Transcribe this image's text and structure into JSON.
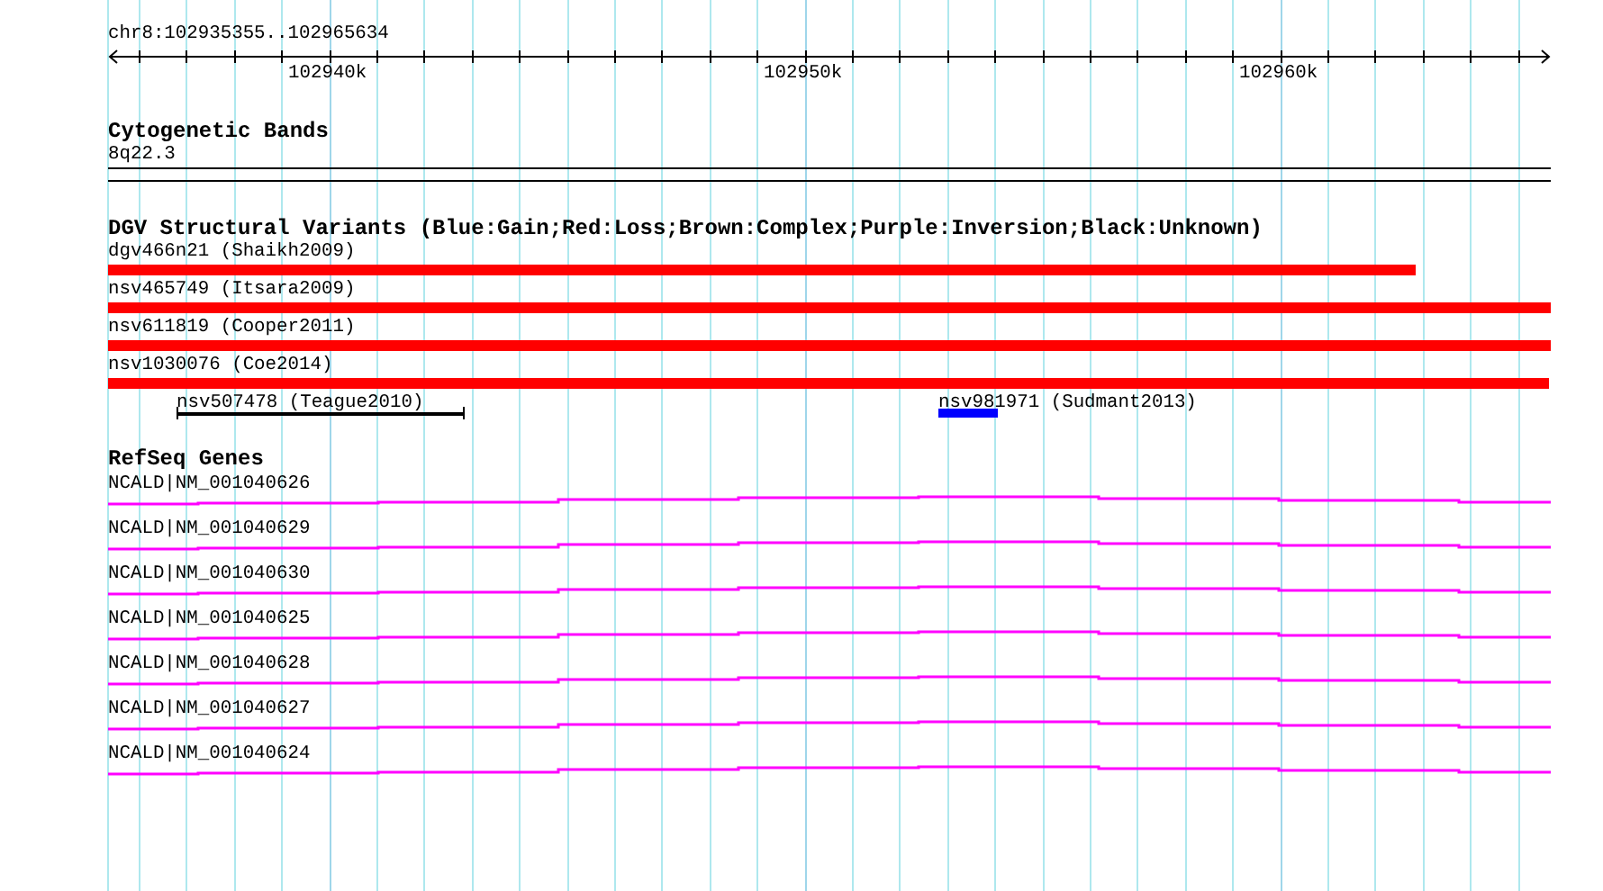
{
  "ruler": {
    "range_label": "chr8:102935355..102965634",
    "tick_labels": [
      "102940k",
      "102950k",
      "102960k"
    ]
  },
  "bands": {
    "title": "Cytogenetic Bands",
    "label": "8q22.3"
  },
  "variants": {
    "title": "DGV Structural Variants (Blue:Gain;Red:Loss;Brown:Complex;Purple:Inversion;Black:Unknown)",
    "rows": [
      {
        "items": [
          {
            "label": "dgv466n21 (Shaikh2009)",
            "kind": "bar",
            "color": "#ff0000"
          }
        ]
      },
      {
        "items": [
          {
            "label": "nsv465749 (Itsara2009)",
            "kind": "bar",
            "color": "#ff0000"
          }
        ]
      },
      {
        "items": [
          {
            "label": "nsv611819 (Cooper2011)",
            "kind": "bar",
            "color": "#ff0000"
          }
        ]
      },
      {
        "items": [
          {
            "label": "nsv1030076 (Coe2014)",
            "kind": "bar",
            "color": "#ff0000"
          }
        ]
      },
      {
        "items": [
          {
            "label": "nsv507478 (Teague2010)",
            "kind": "range",
            "color": "#000000"
          },
          {
            "label": "nsv981971 (Sudmant2013)",
            "kind": "bar",
            "color": "#0000ff"
          }
        ]
      }
    ]
  },
  "genes": {
    "title": "RefSeq Genes",
    "items": [
      {
        "label": "NCALD|NM_001040626"
      },
      {
        "label": "NCALD|NM_001040629"
      },
      {
        "label": "NCALD|NM_001040630"
      },
      {
        "label": "NCALD|NM_001040625"
      },
      {
        "label": "NCALD|NM_001040628"
      },
      {
        "label": "NCALD|NM_001040627"
      },
      {
        "label": "NCALD|NM_001040624"
      }
    ]
  }
}
